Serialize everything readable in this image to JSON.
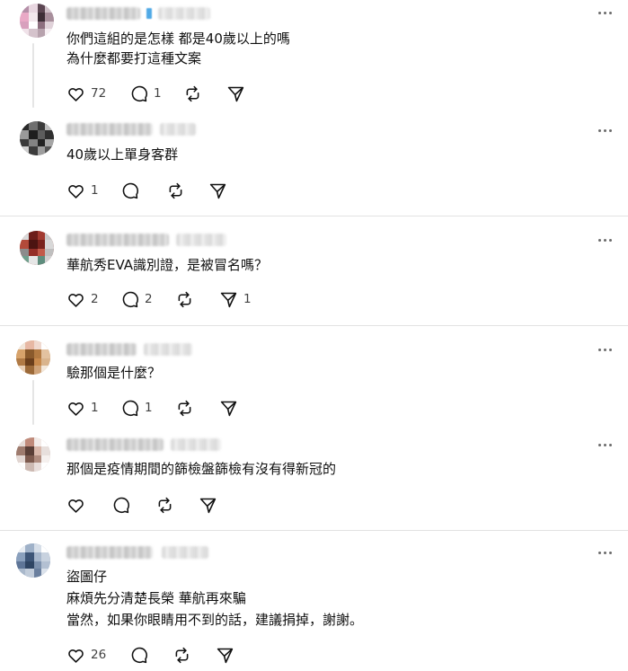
{
  "posts": [
    {
      "lines": [
        "你們這組的是怎樣 都是40歲以上的嗎",
        "為什麼都要打這種文案"
      ],
      "likes": "72",
      "replies": "1",
      "reposts": "",
      "shares": ""
    },
    {
      "lines": [
        "40歲以上單身客群"
      ],
      "likes": "1",
      "replies": "",
      "reposts": "",
      "shares": ""
    },
    {
      "lines": [
        "華航秀EVA識別證，是被冒名嗎？"
      ],
      "likes": "2",
      "replies": "2",
      "reposts": "",
      "shares": "1"
    },
    {
      "lines": [
        "驗那個是什麼？"
      ],
      "likes": "1",
      "replies": "1",
      "reposts": "",
      "shares": ""
    },
    {
      "lines": [
        "那個是疫情期間的篩檢盤篩檢有沒有得新冠的"
      ],
      "likes": "",
      "replies": "",
      "reposts": "",
      "shares": ""
    },
    {
      "lines": [
        "盜圖仔",
        "麻煩先分清楚長榮 華航再來騙",
        "當然，如果你眼睛用不到的話，建議捐掉，謝謝。"
      ],
      "likes": "26",
      "replies": "",
      "reposts": "",
      "shares": ""
    }
  ],
  "icons": {
    "like": "heart-icon",
    "reply": "comment-bubble-icon",
    "repost": "repost-arrows-icon",
    "share": "send-paper-plane-icon",
    "more": "more-horizontal-icon"
  },
  "colors": {
    "text": "#101010",
    "muted": "#424242",
    "divider": "#e2e2e2",
    "verified_badge": "#4fa9e6"
  }
}
